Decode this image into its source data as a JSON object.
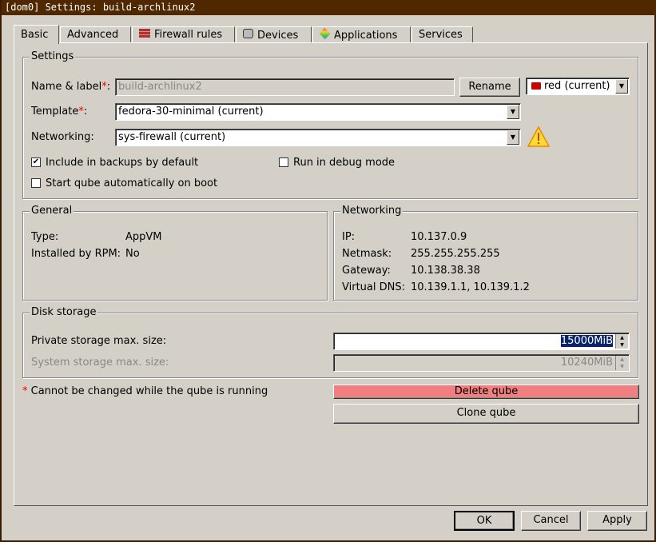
{
  "window": {
    "title": "[dom0] Settings: build-archlinux2"
  },
  "tabs": [
    {
      "label": "Basic",
      "icon": ""
    },
    {
      "label": "Advanced",
      "icon": ""
    },
    {
      "label": "Firewall rules",
      "icon": "firewall-icon"
    },
    {
      "label": "Devices",
      "icon": "devices-icon"
    },
    {
      "label": "Applications",
      "icon": "applications-icon"
    },
    {
      "label": "Services",
      "icon": ""
    }
  ],
  "settings": {
    "title": "Settings",
    "name_label": "Name & label",
    "name_value": "build-archlinux2",
    "rename": "Rename",
    "label_value": "red (current)",
    "label_color": "#cc0000",
    "template_label": "Template",
    "template_value": "fedora-30-minimal (current)",
    "networking_label": "Networking:",
    "networking_value": "sys-firewall (current)",
    "backups": "Include in backups by default",
    "backups_checked": true,
    "debug": "Run in debug mode",
    "debug_checked": false,
    "autostart": "Start qube automatically on boot",
    "autostart_checked": false
  },
  "general": {
    "title": "General",
    "type_label": "Type:",
    "type_value": "AppVM",
    "rpm_label": "Installed by RPM:",
    "rpm_value": "No"
  },
  "networking": {
    "title": "Networking",
    "ip_label": "IP:",
    "ip": "10.137.0.9",
    "netmask_label": "Netmask:",
    "netmask": "255.255.255.255",
    "gateway_label": "Gateway:",
    "gateway": "10.138.38.38",
    "dns_label": "Virtual DNS:",
    "dns": "10.139.1.1, 10.139.1.2"
  },
  "disk": {
    "title": "Disk storage",
    "private_label": "Private storage max. size:",
    "private_value": "15000MiB",
    "system_label": "System storage max. size:",
    "system_value": "10240MiB"
  },
  "note": {
    "star": "*",
    "text": " Cannot be changed while the qube is running"
  },
  "actions": {
    "delete": "Delete qube",
    "clone": "Clone qube",
    "delete_color": "#f08080"
  },
  "footer": {
    "ok": "OK",
    "cancel": "Cancel",
    "apply": "Apply"
  }
}
